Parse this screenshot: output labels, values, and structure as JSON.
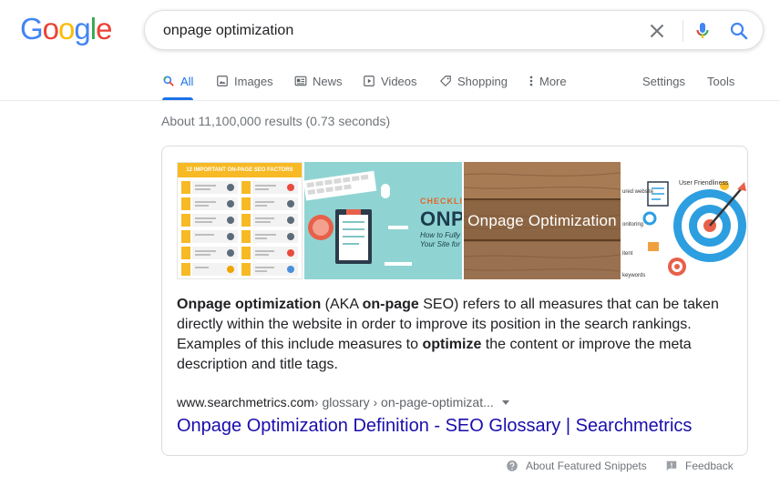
{
  "logo": {
    "letters": [
      "G",
      "o",
      "o",
      "g",
      "l",
      "e"
    ],
    "colors": [
      "#4285f4",
      "#ea4335",
      "#fbbc05",
      "#4285f4",
      "#34a853",
      "#ea4335"
    ]
  },
  "search": {
    "query": "onpage optimization",
    "clear_icon": "close-icon",
    "mic_icon": "mic-icon",
    "search_icon": "search-icon"
  },
  "tabs": [
    {
      "label": "All",
      "icon": "search-icon",
      "active": true
    },
    {
      "label": "Images",
      "icon": "image-icon"
    },
    {
      "label": "News",
      "icon": "news-icon"
    },
    {
      "label": "Videos",
      "icon": "video-icon"
    },
    {
      "label": "Shopping",
      "icon": "tag-icon"
    },
    {
      "label": "More",
      "icon": "more-vert-icon"
    },
    {
      "label": "Settings"
    },
    {
      "label": "Tools"
    }
  ],
  "stats": "About 11,100,000 results (0.73 seconds)",
  "images": {
    "thumb1": {
      "header": "12 IMPORTANT ON-PAGE SEO FACTORS",
      "numbers": [
        "01",
        "02",
        "03",
        "04",
        "05",
        "06",
        "07",
        "08",
        "09",
        "10",
        "11",
        "12"
      ]
    },
    "thumb2": {
      "line1": "CHECKLIST",
      "line2": "ONPA",
      "sub1": "How to Fully",
      "sub2": "Your Site for"
    },
    "thumb3": {
      "label": "Onpage Optimization"
    },
    "thumb4": {
      "title": "User Friendliness",
      "labels": [
        "ured website",
        "onitoring",
        "itent",
        "keywords"
      ]
    }
  },
  "snippet": {
    "b1": "Onpage optimization",
    "t1": " (AKA ",
    "b2": "on-page",
    "t2": " SEO) refers to all measures that can be taken directly within the website in order to improve its position in the search rankings. Examples of this include measures to ",
    "b3": "optimize",
    "t3": " the content or improve the meta description and title tags."
  },
  "cite": {
    "domain": "www.searchmetrics.com",
    "path": " › glossary › on-page-optimizat..."
  },
  "result_title": "Onpage Optimization Definition - SEO Glossary | Searchmetrics",
  "footer": {
    "about": "About Featured Snippets",
    "feedback": "Feedback"
  },
  "colors": {
    "link": "#1a0dab",
    "accent": "#1a73e8",
    "muted": "#70757a"
  }
}
